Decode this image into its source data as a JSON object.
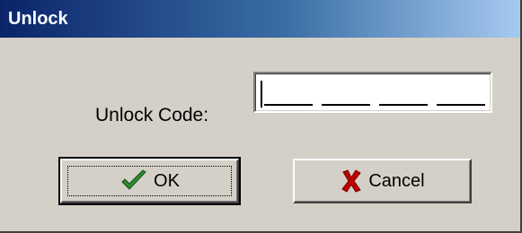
{
  "window": {
    "title": "Unlock"
  },
  "form": {
    "code_label": "Unlock Code:",
    "code_value": ""
  },
  "buttons": {
    "ok_label": "OK",
    "ok_icon": "checkmark-icon",
    "cancel_label": "Cancel",
    "cancel_icon": "x-icon"
  },
  "colors": {
    "titlebar_start": "#0a246a",
    "titlebar_end": "#a6caf0",
    "face": "#d4d0c8",
    "check_green": "#2e8b2e",
    "x_red": "#c00000"
  }
}
